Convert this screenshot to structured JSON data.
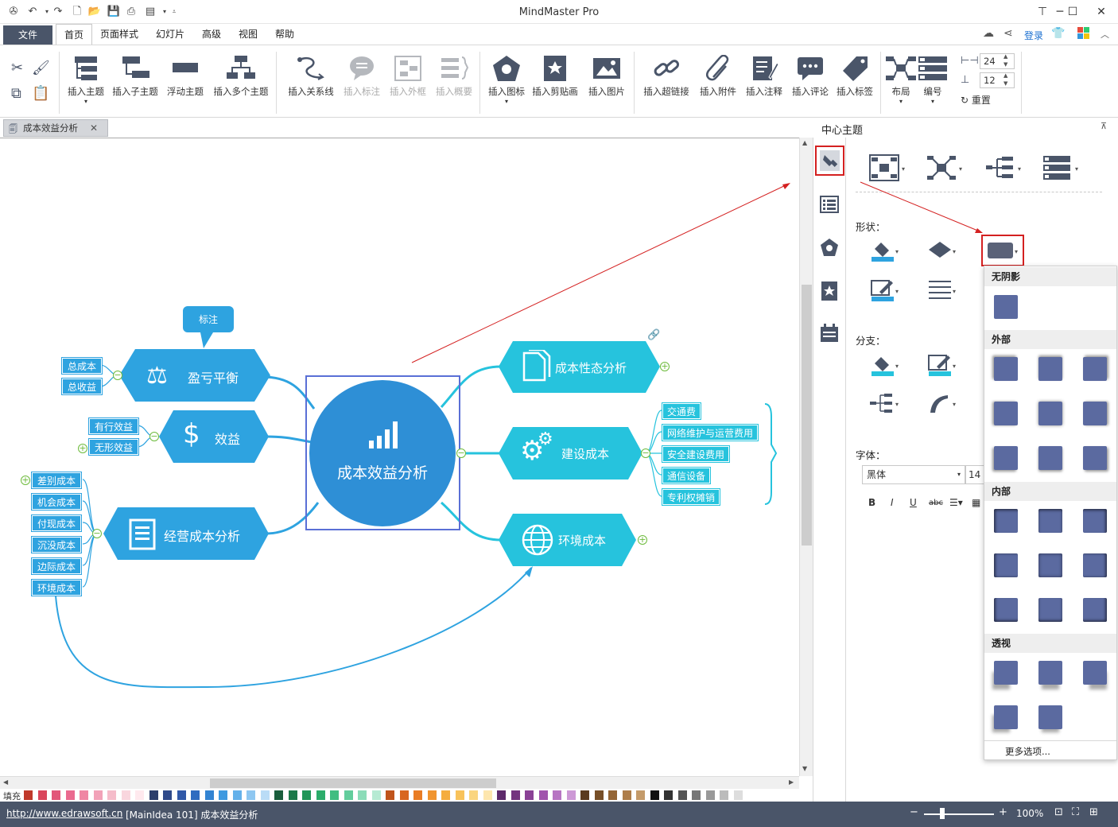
{
  "app": {
    "title": "MindMaster Pro"
  },
  "titlebar": {
    "login": "登录"
  },
  "menu": {
    "file": "文件",
    "home": "首页",
    "page_style": "页面样式",
    "slides": "幻灯片",
    "advanced": "高级",
    "view": "视图",
    "help": "帮助"
  },
  "ribbon": {
    "insert_topic": "插入主题",
    "insert_subtopic": "插入子主题",
    "floating_topic": "浮动主题",
    "insert_multi": "插入多个主题",
    "insert_relation": "插入关系线",
    "insert_callout": "插入标注",
    "insert_boundary": "插入外框",
    "insert_summary": "插入概要",
    "insert_icon": "插入图标",
    "insert_clipart": "插入剪贴画",
    "insert_image": "插入图片",
    "insert_hyperlink": "插入超链接",
    "insert_attachment": "插入附件",
    "insert_note": "插入注释",
    "insert_comment": "插入评论",
    "insert_tag": "插入标签",
    "layout": "布局",
    "numbering": "编号",
    "spacing_h": "24",
    "spacing_v": "12",
    "reset": "重置"
  },
  "doc_tab": {
    "title": "成本效益分析"
  },
  "mindmap": {
    "central": "成本效益分析",
    "callout": "标注",
    "left": [
      {
        "label": "盈亏平衡",
        "children": [
          "总成本",
          "总收益"
        ]
      },
      {
        "label": "效益",
        "children": [
          "有行效益",
          "无形效益"
        ]
      },
      {
        "label": "经营成本分析",
        "children": [
          "差别成本",
          "机会成本",
          "付现成本",
          "沉没成本",
          "边际成本",
          "环境成本"
        ]
      }
    ],
    "right": [
      {
        "label": "成本性态分析",
        "children": []
      },
      {
        "label": "建设成本",
        "children": [
          "交通费",
          "网络维护与运营费用",
          "安全建设费用",
          "通信设备",
          "专利权摊销"
        ]
      },
      {
        "label": "环境成本",
        "children": []
      }
    ]
  },
  "palette": {
    "fill_label": "填充"
  },
  "status": {
    "url": "http://www.edrawsoft.cn",
    "info": "[MainIdea 101]  成本效益分析",
    "zoom": "100%"
  },
  "panel": {
    "title": "中心主题",
    "shape_label": "形状：",
    "branch_label": "分支：",
    "font_label": "字体：",
    "font_name": "黑体",
    "font_size": "14"
  },
  "dropdown": {
    "no_shadow": "无阴影",
    "outer": "外部",
    "inner": "内部",
    "perspective": "透视",
    "more": "更多选项..."
  },
  "colors": {
    "accent": "#2ea3e0",
    "cyan": "#26c3dd",
    "status_bg": "#4a5569",
    "swatch": "#5b6aa0"
  }
}
